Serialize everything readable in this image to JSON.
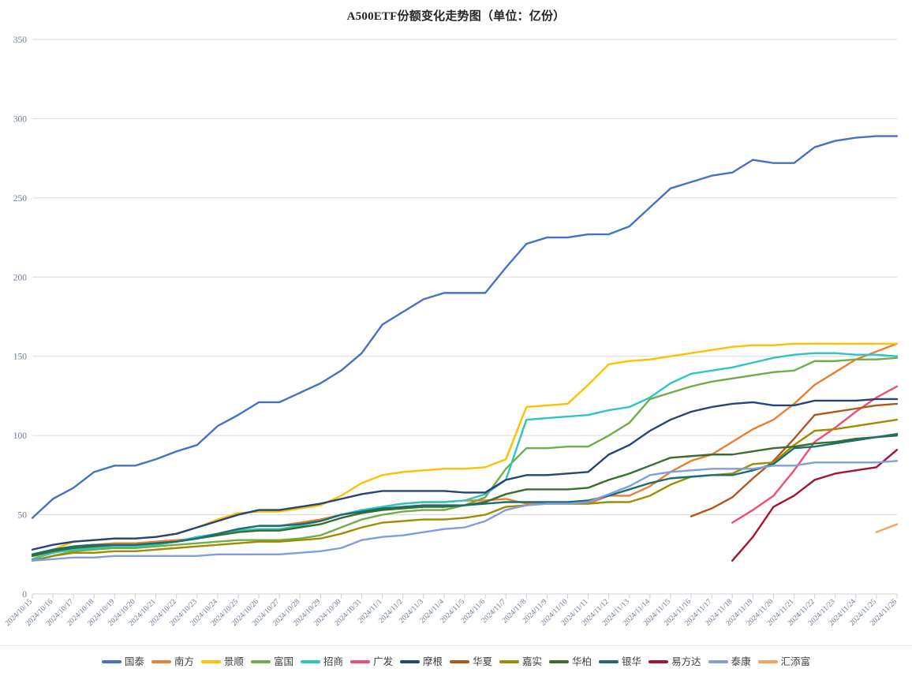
{
  "chart_data": {
    "type": "line",
    "title": "A500ETF份额变化走势图（单位：亿份）",
    "xlabel": "",
    "ylabel": "",
    "ylim": [
      0,
      350
    ],
    "yticks": [
      0,
      50,
      100,
      150,
      200,
      250,
      300,
      350
    ],
    "grid": true,
    "legend_position": "bottom",
    "categories": [
      "2024/10/15",
      "2024/10/16",
      "2024/10/17",
      "2024/10/18",
      "2024/10/19",
      "2024/10/20",
      "2024/10/21",
      "2024/10/22",
      "2024/10/23",
      "2024/10/24",
      "2024/10/25",
      "2024/10/26",
      "2024/10/27",
      "2024/10/28",
      "2024/10/29",
      "2024/10/30",
      "2024/10/31",
      "2024/11/1",
      "2024/11/2",
      "2024/11/3",
      "2024/11/4",
      "2024/11/5",
      "2024/11/6",
      "2024/11/7",
      "2024/11/8",
      "2024/11/9",
      "2024/11/10",
      "2024/11/11",
      "2024/11/12",
      "2024/11/13",
      "2024/11/14",
      "2024/11/15",
      "2024/11/16",
      "2024/11/17",
      "2024/11/18",
      "2024/11/19",
      "2024/11/20",
      "2024/11/21",
      "2024/11/22",
      "2024/11/23",
      "2024/11/24",
      "2024/11/25",
      "2024/11/26"
    ],
    "series": [
      {
        "name": "国泰",
        "color": "#4472C4",
        "values": [
          48,
          60,
          67,
          77,
          81,
          81,
          85,
          90,
          94,
          106,
          113,
          121,
          121,
          127,
          133,
          141,
          152,
          170,
          178,
          186,
          190,
          190,
          190,
          206,
          221,
          225,
          225,
          227,
          227,
          232,
          244,
          256,
          260,
          264,
          266,
          274,
          272,
          272,
          282,
          286,
          288,
          289,
          289
        ]
      },
      {
        "name": "南方",
        "color": "#ED7D31",
        "values": [
          24,
          27,
          30,
          31,
          32,
          32,
          33,
          34,
          35,
          38,
          41,
          43,
          43,
          45,
          47,
          50,
          52,
          55,
          57,
          58,
          58,
          59,
          59,
          60,
          57,
          57,
          57,
          57,
          62,
          62,
          68,
          77,
          84,
          88,
          96,
          104,
          110,
          120,
          132,
          140,
          148,
          153,
          158
        ]
      },
      {
        "name": "景顺",
        "color": "#FFC000",
        "values": [
          22,
          28,
          33,
          34,
          35,
          35,
          36,
          38,
          42,
          47,
          51,
          52,
          52,
          54,
          56,
          62,
          70,
          75,
          77,
          78,
          79,
          79,
          80,
          85,
          118,
          119,
          120,
          132,
          145,
          147,
          148,
          150,
          152,
          154,
          156,
          157,
          157,
          158,
          158,
          158,
          158,
          158,
          158
        ]
      },
      {
        "name": "富国",
        "color": "#70AD47",
        "values": [
          21,
          24,
          27,
          28,
          29,
          29,
          30,
          31,
          32,
          33,
          34,
          34,
          34,
          35,
          37,
          42,
          47,
          50,
          52,
          53,
          53,
          56,
          61,
          79,
          92,
          92,
          93,
          93,
          100,
          108,
          123,
          127,
          131,
          134,
          136,
          138,
          140,
          141,
          147,
          147,
          148,
          148,
          149
        ]
      },
      {
        "name": "招商",
        "color": "#2EC4C4",
        "values": [
          22,
          26,
          28,
          29,
          30,
          30,
          31,
          33,
          36,
          38,
          40,
          41,
          41,
          43,
          46,
          50,
          53,
          55,
          57,
          58,
          58,
          59,
          63,
          72,
          110,
          111,
          112,
          113,
          116,
          118,
          124,
          133,
          139,
          141,
          143,
          146,
          149,
          151,
          152,
          152,
          151,
          151,
          150
        ]
      },
      {
        "name": "广发",
        "color": "#F04E6E",
        "values": [
          null,
          null,
          null,
          null,
          null,
          null,
          null,
          null,
          null,
          null,
          null,
          null,
          null,
          null,
          null,
          null,
          null,
          null,
          null,
          null,
          null,
          null,
          null,
          null,
          null,
          null,
          null,
          null,
          null,
          null,
          null,
          null,
          null,
          null,
          45,
          53,
          62,
          78,
          96,
          105,
          115,
          124,
          131
        ]
      },
      {
        "name": "摩根",
        "color": "#264478",
        "values": [
          28,
          31,
          33,
          34,
          35,
          35,
          36,
          38,
          42,
          46,
          50,
          53,
          53,
          55,
          57,
          60,
          63,
          65,
          65,
          65,
          65,
          64,
          64,
          72,
          75,
          75,
          76,
          77,
          88,
          94,
          103,
          110,
          115,
          118,
          120,
          121,
          119,
          119,
          122,
          122,
          122,
          123,
          123
        ]
      },
      {
        "name": "华夏",
        "color": "#B4561A",
        "values": [
          null,
          null,
          null,
          null,
          null,
          null,
          null,
          null,
          null,
          null,
          null,
          null,
          null,
          null,
          null,
          null,
          null,
          null,
          null,
          null,
          null,
          null,
          null,
          null,
          null,
          null,
          null,
          null,
          null,
          null,
          null,
          null,
          49,
          54,
          61,
          73,
          84,
          98,
          113,
          115,
          117,
          119,
          120
        ]
      },
      {
        "name": "嘉实",
        "color": "#A08C00",
        "values": [
          21,
          24,
          26,
          26,
          27,
          27,
          28,
          29,
          30,
          31,
          32,
          33,
          33,
          34,
          35,
          38,
          42,
          45,
          46,
          47,
          47,
          48,
          50,
          55,
          56,
          57,
          57,
          57,
          58,
          58,
          62,
          69,
          74,
          75,
          76,
          82,
          83,
          94,
          103,
          104,
          106,
          108,
          110
        ]
      },
      {
        "name": "华柏",
        "color": "#376E2B",
        "values": [
          24,
          27,
          29,
          30,
          31,
          31,
          32,
          33,
          35,
          37,
          39,
          40,
          40,
          42,
          44,
          48,
          51,
          53,
          54,
          55,
          55,
          56,
          58,
          63,
          66,
          66,
          66,
          67,
          72,
          76,
          81,
          86,
          87,
          88,
          88,
          90,
          92,
          93,
          95,
          96,
          98,
          99,
          100
        ]
      },
      {
        "name": "银华",
        "color": "#1A6E6E",
        "values": [
          25,
          28,
          30,
          31,
          31,
          31,
          32,
          33,
          35,
          38,
          41,
          43,
          43,
          44,
          46,
          50,
          52,
          54,
          55,
          56,
          56,
          56,
          57,
          58,
          58,
          58,
          58,
          59,
          62,
          66,
          70,
          73,
          74,
          75,
          75,
          78,
          82,
          92,
          93,
          95,
          97,
          99,
          101
        ]
      },
      {
        "name": "易方达",
        "color": "#A5152F",
        "values": [
          null,
          null,
          null,
          null,
          null,
          null,
          null,
          null,
          null,
          null,
          null,
          null,
          null,
          null,
          null,
          null,
          null,
          null,
          null,
          null,
          null,
          null,
          null,
          null,
          null,
          null,
          null,
          null,
          null,
          null,
          null,
          null,
          null,
          null,
          21,
          36,
          55,
          62,
          72,
          76,
          78,
          80,
          91
        ]
      },
      {
        "name": "泰康",
        "color": "#7E9EE0",
        "values": [
          21,
          22,
          23,
          23,
          24,
          24,
          24,
          24,
          24,
          25,
          25,
          25,
          25,
          26,
          27,
          29,
          34,
          36,
          37,
          39,
          41,
          42,
          46,
          53,
          56,
          57,
          57,
          58,
          63,
          68,
          75,
          77,
          78,
          79,
          79,
          79,
          81,
          81,
          83,
          83,
          83,
          83,
          84
        ]
      },
      {
        "name": "汇添富",
        "color": "#F5A35C",
        "values": [
          null,
          null,
          null,
          null,
          null,
          null,
          null,
          null,
          null,
          null,
          null,
          null,
          null,
          null,
          null,
          null,
          null,
          null,
          null,
          null,
          null,
          null,
          null,
          null,
          null,
          null,
          null,
          null,
          null,
          null,
          null,
          null,
          null,
          null,
          null,
          null,
          null,
          null,
          null,
          null,
          null,
          39,
          44
        ]
      }
    ]
  }
}
